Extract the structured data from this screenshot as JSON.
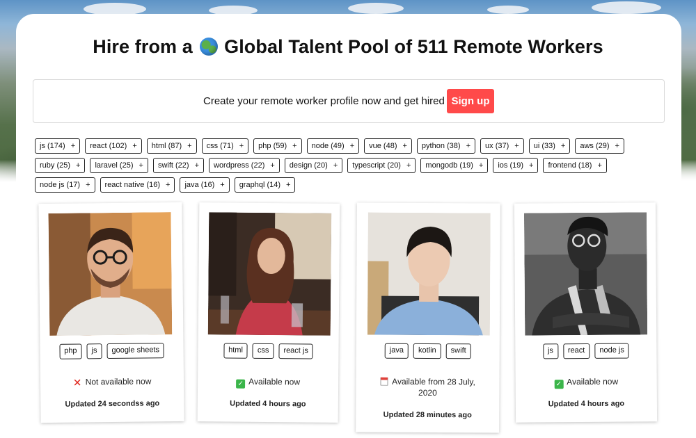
{
  "header": {
    "title_before": "Hire from a",
    "title_after": "Global Talent Pool of 511 Remote Workers",
    "globe_icon": "globe-emoji"
  },
  "signup": {
    "prompt": "Create your remote worker profile now and get hired",
    "button_label": "Sign up",
    "button_color": "#ff4a4a"
  },
  "tags": [
    {
      "label": "js (174)",
      "add": "+"
    },
    {
      "label": "react (102)",
      "add": "+"
    },
    {
      "label": "html (87)",
      "add": "+"
    },
    {
      "label": "css (71)",
      "add": "+"
    },
    {
      "label": "php (59)",
      "add": "+"
    },
    {
      "label": "node (49)",
      "add": "+"
    },
    {
      "label": "vue (48)",
      "add": "+"
    },
    {
      "label": "python (38)",
      "add": "+"
    },
    {
      "label": "ux (37)",
      "add": "+"
    },
    {
      "label": "ui (33)",
      "add": "+"
    },
    {
      "label": "aws (29)",
      "add": "+"
    },
    {
      "label": "ruby (25)",
      "add": "+"
    },
    {
      "label": "laravel (25)",
      "add": "+"
    },
    {
      "label": "swift (22)",
      "add": "+"
    },
    {
      "label": "wordpress (22)",
      "add": "+"
    },
    {
      "label": "design (20)",
      "add": "+"
    },
    {
      "label": "typescript (20)",
      "add": "+"
    },
    {
      "label": "mongodb (19)",
      "add": "+"
    },
    {
      "label": "ios (19)",
      "add": "+"
    },
    {
      "label": "frontend (18)",
      "add": "+"
    },
    {
      "label": "node js (17)",
      "add": "+"
    },
    {
      "label": "react native (16)",
      "add": "+"
    },
    {
      "label": "java (16)",
      "add": "+"
    },
    {
      "label": "graphql (14)",
      "add": "+"
    }
  ],
  "workers": [
    {
      "skills": [
        "php",
        "js",
        "google sheets"
      ],
      "availability_icon": "x-icon",
      "availability": "Not available now",
      "updated": "Updated 24 secondss ago"
    },
    {
      "skills": [
        "html",
        "css",
        "react js"
      ],
      "availability_icon": "check-icon",
      "availability": "Available now",
      "updated": "Updated 4 hours ago"
    },
    {
      "skills": [
        "java",
        "kotlin",
        "swift"
      ],
      "availability_icon": "calendar-icon",
      "availability": "Available from 28 July,",
      "availability_line2": "2020",
      "updated": "Updated 28 minutes ago"
    },
    {
      "skills": [
        "js",
        "react",
        "node js"
      ],
      "availability_icon": "check-icon",
      "availability": "Available now",
      "updated": "Updated 4 hours ago"
    }
  ]
}
